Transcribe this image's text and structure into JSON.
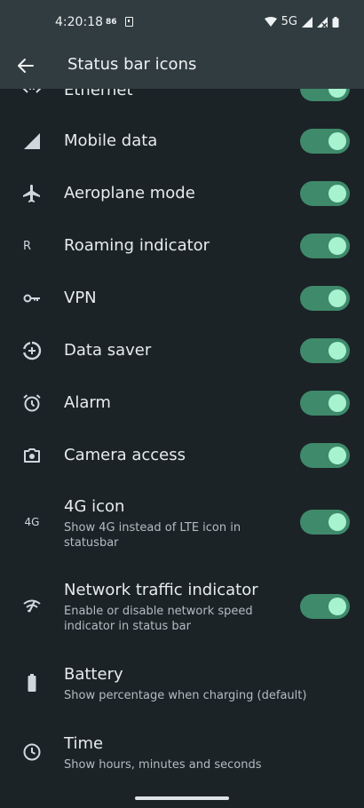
{
  "status_bar": {
    "time": "4:20:18",
    "badge": "86",
    "network": "5G"
  },
  "app_bar": {
    "title": "Status bar icons"
  },
  "items": [
    {
      "label": "Ethernet",
      "icon": "ethernet-icon",
      "enabled": true
    },
    {
      "label": "Mobile data",
      "icon": "signal-icon",
      "enabled": true
    },
    {
      "label": "Aeroplane mode",
      "icon": "airplane-icon",
      "enabled": true
    },
    {
      "label": "Roaming indicator",
      "icon": "roaming-icon",
      "icon_text": "R",
      "enabled": true
    },
    {
      "label": "VPN",
      "icon": "vpn-key-icon",
      "enabled": true
    },
    {
      "label": "Data saver",
      "icon": "data-saver-icon",
      "enabled": true
    },
    {
      "label": "Alarm",
      "icon": "alarm-icon",
      "enabled": true
    },
    {
      "label": "Camera access",
      "icon": "camera-icon",
      "enabled": true
    },
    {
      "label": "4G icon",
      "subtitle": "Show 4G instead of LTE icon in statusbar",
      "icon": "4g-icon",
      "icon_text": "4G",
      "enabled": true
    },
    {
      "label": "Network traffic indicator",
      "subtitle": "Enable or disable network speed indicator in status bar",
      "icon": "network-traffic-icon",
      "enabled": true
    },
    {
      "label": "Battery",
      "subtitle": "Show percentage when charging (default)",
      "icon": "battery-icon"
    },
    {
      "label": "Time",
      "subtitle": "Show hours, minutes and seconds",
      "icon": "clock-icon"
    }
  ],
  "colors": {
    "background": "#1b2327",
    "bar": "#313c40",
    "toggle_track": "#3f8a6b",
    "toggle_knob": "#a7f3d0"
  }
}
